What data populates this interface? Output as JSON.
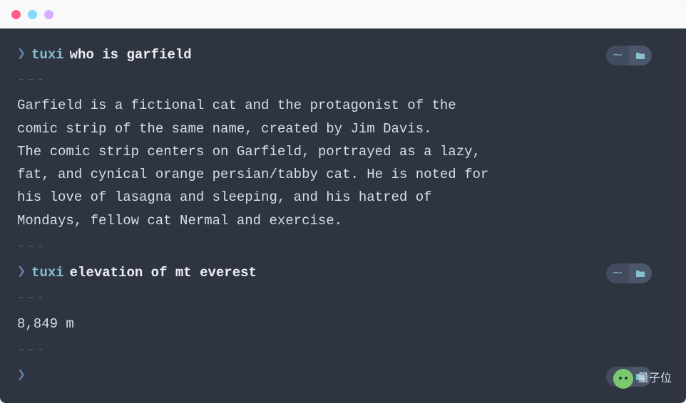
{
  "terminal": {
    "blocks": [
      {
        "prompt": "❯",
        "command": "tuxi",
        "args": "who is garfield",
        "separator": "---",
        "output": "Garfield is a fictional cat and the protagonist of the\ncomic strip of the same name, created by Jim Davis.\nThe comic strip centers on Garfield, portrayed as a lazy,\nfat, and cynical orange persian/tabby cat. He is noted for\nhis love of lasagna and sleeping, and his hatred of\nMondays, fellow cat Nermal and exercise.",
        "closing_separator": "---"
      },
      {
        "prompt": "❯",
        "command": "tuxi",
        "args": "elevation of mt everest",
        "separator": "---",
        "output": "8,849 m",
        "closing_separator": "---"
      },
      {
        "prompt": "❯",
        "command": "",
        "args": ""
      }
    ],
    "action_icons": {
      "bolt": "⁓",
      "folder": "folder-icon"
    }
  },
  "watermark": {
    "text": "量子位"
  }
}
